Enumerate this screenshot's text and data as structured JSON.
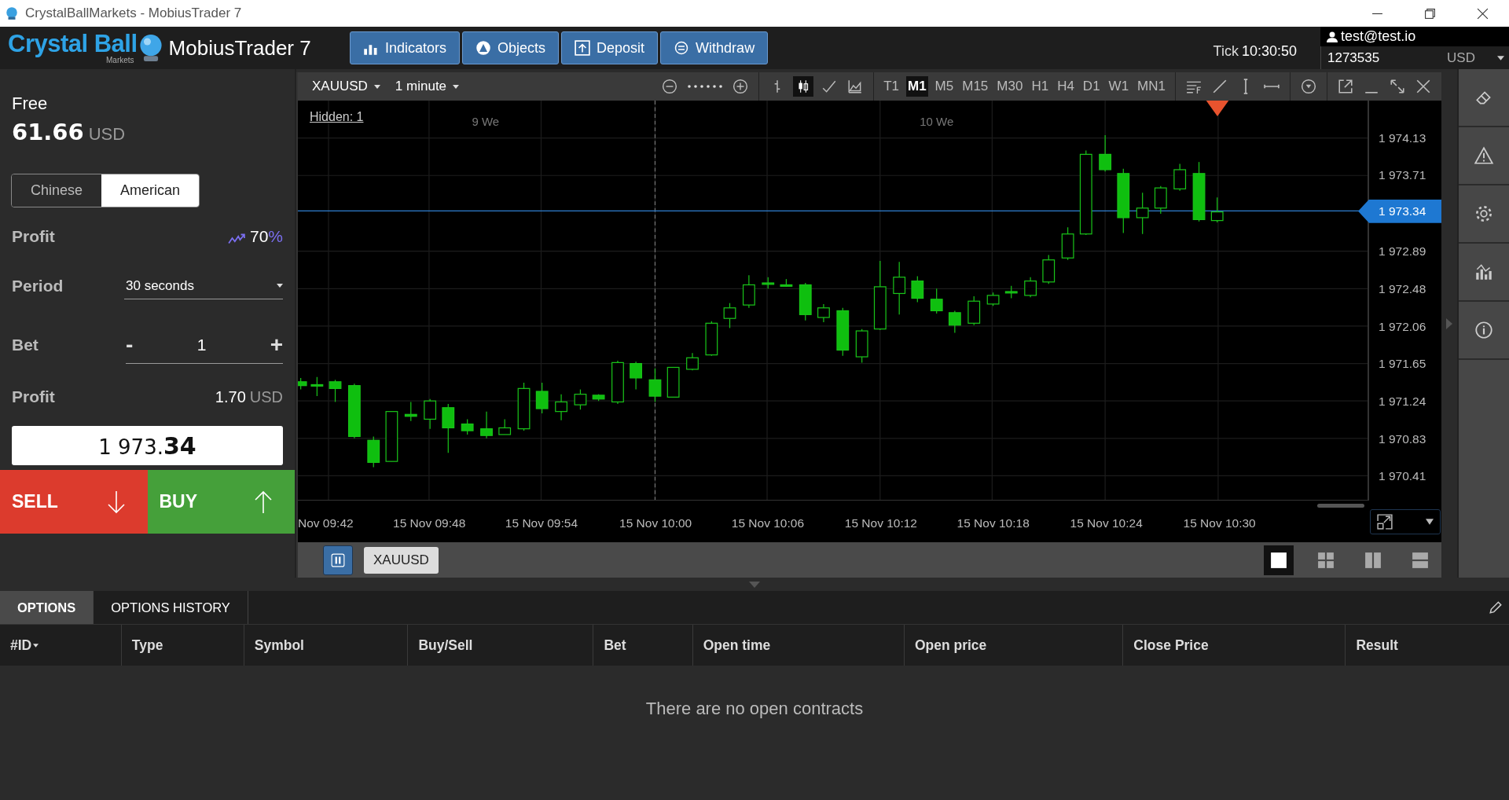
{
  "window": {
    "title": "CrystalBallMarkets - MobiusTrader 7"
  },
  "header": {
    "logo_text": "Crystal Ball",
    "logo_sub": "Markets",
    "app_name": "MobiusTrader 7",
    "buttons": [
      {
        "label": "Indicators",
        "kind": "bars"
      },
      {
        "label": "Objects",
        "kind": "objects"
      },
      {
        "label": "Deposit",
        "kind": "deposit"
      },
      {
        "label": "Withdraw",
        "kind": "withdraw"
      }
    ],
    "tick_label": "Tick",
    "tick_time": "10:30:50",
    "account_email": "test@test.io",
    "account_number": "1273535",
    "account_currency": "USD"
  },
  "trade_panel": {
    "free_label": "Free",
    "free_amount": "61.66",
    "free_currency": "USD",
    "option_types": [
      {
        "label": "Chinese",
        "selected": false
      },
      {
        "label": "American",
        "selected": true
      }
    ],
    "profit_label": "Profit",
    "profit_value": "70",
    "profit_unit": "%",
    "period_label": "Period",
    "period_value": "30 seconds",
    "bet_label": "Bet",
    "bet_minus": "-",
    "bet_value": "1",
    "bet_plus": "+",
    "payout_label": "Profit",
    "payout_amount": "1.70",
    "payout_currency": "USD",
    "price": "1 973.**34**",
    "sell_label": "SELL",
    "buy_label": "BUY"
  },
  "chart": {
    "symbol": "XAUUSD",
    "timeframe": "1 minute",
    "periods": [
      {
        "label": "T1",
        "selected": false
      },
      {
        "label": "M1",
        "selected": true
      },
      {
        "label": "M5",
        "selected": false
      },
      {
        "label": "M15",
        "selected": false
      },
      {
        "label": "M30",
        "selected": false
      },
      {
        "label": "H1",
        "selected": false
      },
      {
        "label": "H4",
        "selected": false
      },
      {
        "label": "D1",
        "selected": false
      },
      {
        "label": "W1",
        "selected": false
      },
      {
        "label": "MN1",
        "selected": false
      }
    ],
    "hidden_link": "Hidden: 1",
    "day_labels": [
      "9 We",
      "10 We"
    ],
    "price_ticks": [
      "1 974.13",
      "1 973.71",
      "1 972.89",
      "1 972.48",
      "1 972.06",
      "1 971.65",
      "1 971.24",
      "1 970.83",
      "1 970.41"
    ],
    "current_price": "1 973.34",
    "time_ticks": [
      "Nov 09:42",
      "15 Nov 09:48",
      "15 Nov 09:54",
      "15 Nov 10:00",
      "15 Nov 10:06",
      "15 Nov 10:12",
      "15 Nov 10:18",
      "15 Nov 10:24",
      "15 Nov 10:30"
    ],
    "tab_symbol": "XAUUSD",
    "layouts": [
      {
        "selected": true
      },
      {
        "selected": false
      },
      {
        "selected": false
      },
      {
        "selected": false
      }
    ]
  },
  "orders": {
    "tabs": [
      {
        "label": "OPTIONS",
        "selected": true
      },
      {
        "label": "OPTIONS HISTORY",
        "selected": false
      }
    ],
    "columns": [
      "#ID",
      "Type",
      "Symbol",
      "Buy/Sell",
      "Bet",
      "Open time",
      "Open price",
      "Close Price",
      "Result"
    ],
    "empty_message": "There are no open contracts"
  }
}
